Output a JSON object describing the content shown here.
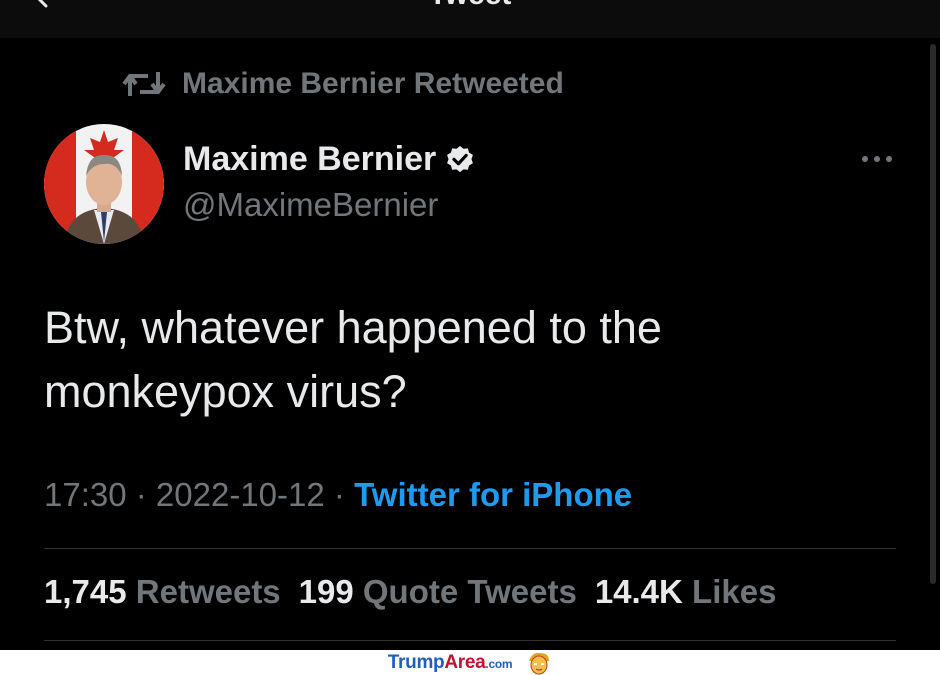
{
  "header": {
    "title": "Tweet"
  },
  "retweet": {
    "label": "Maxime Bernier Retweeted"
  },
  "author": {
    "display_name": "Maxime Bernier",
    "handle": "@MaximeBernier"
  },
  "tweet": {
    "text": "Btw, whatever happened to the monkeypox virus?",
    "time": "17:30",
    "separator": " · ",
    "date": "2022-10-12",
    "source": "Twitter for iPhone"
  },
  "stats": {
    "retweets_value": "1,745",
    "retweets_label": "Retweets",
    "quotes_value": "199",
    "quotes_label": "Quote Tweets",
    "likes_value": "14.4K",
    "likes_label": "Likes"
  },
  "footer": {
    "brand_part1": "Trump",
    "brand_part2": "Area",
    "brand_part3": ".com"
  },
  "colors": {
    "background": "#000000",
    "text_primary": "#e7e9ea",
    "text_secondary": "#71767b",
    "accent": "#1d9bf0"
  },
  "icons": {
    "back": "back-arrow-icon",
    "retweet": "retweet-icon",
    "verified": "verified-badge-icon",
    "more": "more-options-icon"
  }
}
